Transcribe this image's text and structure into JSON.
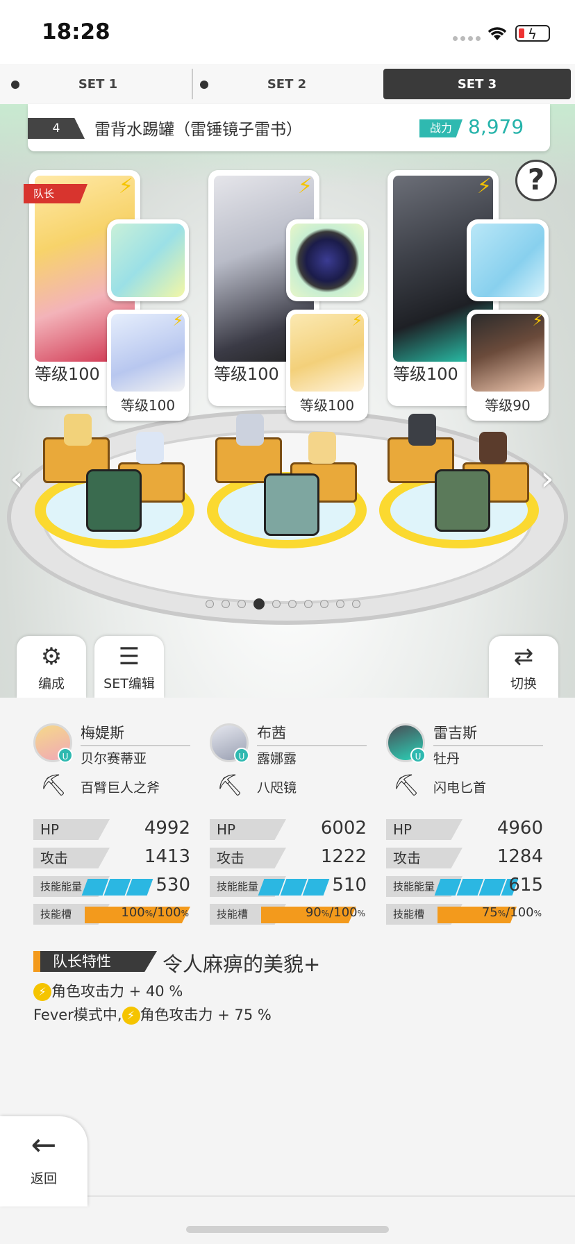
{
  "status": {
    "time": "18:28"
  },
  "tabs": [
    {
      "label": "SET 1",
      "active": false
    },
    {
      "label": "SET 2",
      "active": false
    },
    {
      "label": "SET 3",
      "active": true
    }
  ],
  "team": {
    "number": "4",
    "name": "雷背水踢罐（雷锤镜子雷书）",
    "power_label": "战力",
    "power": "8,979"
  },
  "leader_tag": "队长",
  "help": "?",
  "cards": [
    {
      "level": "等级100",
      "sub_level": "等级100"
    },
    {
      "level": "等级100",
      "sub_level": "等级100"
    },
    {
      "level": "等级100",
      "sub_level": "等级90"
    }
  ],
  "page_dots": {
    "total": 10,
    "active": 4
  },
  "actions": {
    "formation": "编成",
    "set_edit": "SET编辑",
    "switch": "切换"
  },
  "members": [
    {
      "name": "梅媞斯",
      "sub": "贝尔赛蒂亚",
      "weapon": "百臂巨人之斧",
      "hp": "4992",
      "atk": "1413",
      "energy": "530",
      "slot": "100",
      "slot_max": "/100"
    },
    {
      "name": "布茜",
      "sub": "露娜露",
      "weapon": "八咫镜",
      "hp": "6002",
      "atk": "1222",
      "energy": "510",
      "slot": "90",
      "slot_max": "/100"
    },
    {
      "name": "雷吉斯",
      "sub": "牡丹",
      "weapon": "闪电匕首",
      "hp": "4960",
      "atk": "1284",
      "energy": "615",
      "slot": "75",
      "slot_max": "/100"
    }
  ],
  "labels": {
    "hp": "HP",
    "atk": "攻击",
    "energy": "技能能量",
    "slot": "技能槽",
    "pct": "%"
  },
  "leader_skill": {
    "label": "队长特性",
    "name": "令人麻痹的美貌+",
    "effect1": "角色攻击力 + 40 %",
    "effect2_prefix": "Fever模式中,",
    "effect2": "角色攻击力 + 75 %"
  },
  "back": {
    "arrow": "←",
    "label": "返回"
  }
}
